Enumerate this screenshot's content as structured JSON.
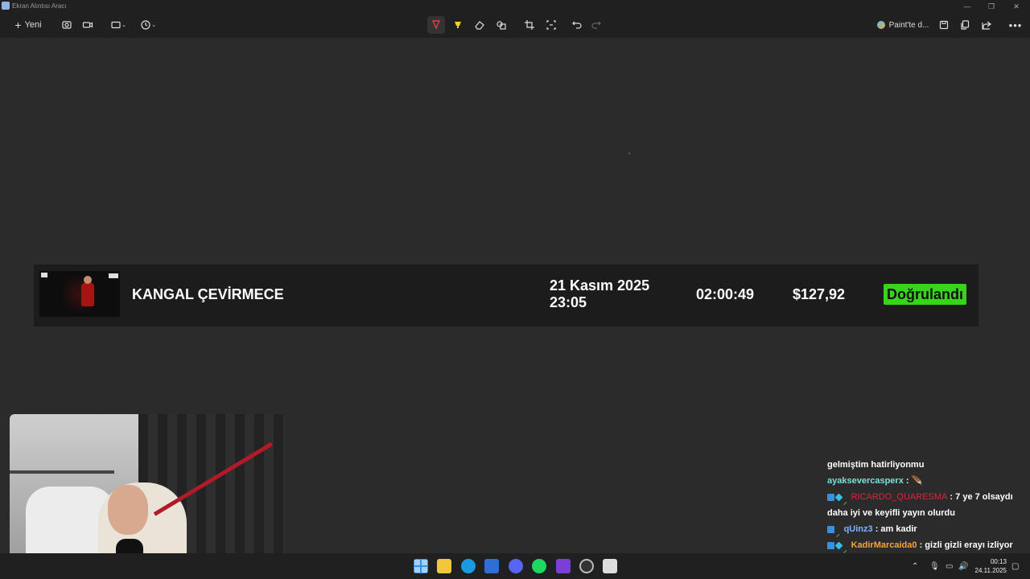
{
  "window": {
    "title": "Ekran Alıntısı Aracı",
    "controls": [
      "—",
      "❐",
      "✕"
    ]
  },
  "toolbar": {
    "new_label": "Yeni",
    "paint_label": "Paint'te d..."
  },
  "colors": {
    "accent": "#4cc2ff",
    "verified": "#39d31e",
    "background": "#2b2b2b",
    "chrome": "#202020"
  },
  "stream_row": {
    "title": "KANGAL ÇEVİRMECE",
    "date_line1": "21 Kasım 2025",
    "date_line2": "23:05",
    "duration": "02:00:49",
    "amount": "$127,92",
    "status": "Doğrulandı"
  },
  "chat": [
    {
      "user": "",
      "message": "gelmiştim hatirliyonmu",
      "user_color": "#ffffff"
    },
    {
      "user": "ayaksevercasperx",
      "message": " : ",
      "user_color": "#7de0d8",
      "emote": "🪶"
    },
    {
      "user": "RICARDO_QUARESMA",
      "message": " : 7 ye 7 olsaydı",
      "user_color": "#e0233c"
    },
    {
      "user": "",
      "message": "daha iyi ve keyifli yayın olurdu",
      "user_color": "#ffffff"
    },
    {
      "user": "qUinz3",
      "message": " : am kadir",
      "user_color": "#7fb6ff"
    },
    {
      "user": "KadirMarcaida0",
      "message": " : gizli gizli erayı izliyor",
      "user_color": "#f2a63a"
    }
  ],
  "taskbar": {
    "time": "00:13",
    "date": "24.11.2025"
  }
}
